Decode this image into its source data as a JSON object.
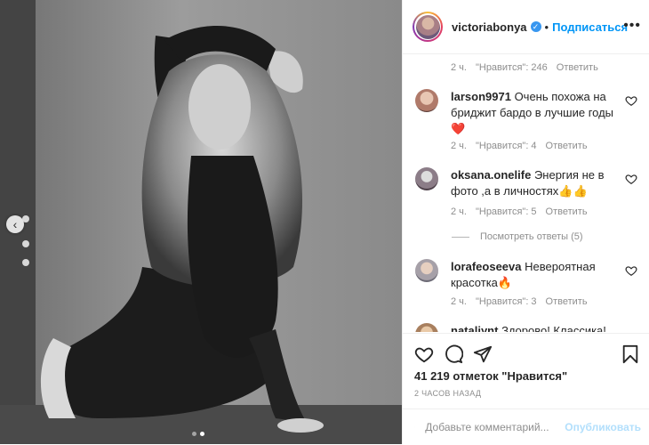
{
  "post": {
    "username": "victoriabonya",
    "follow_label": "Подписаться",
    "separator": "•",
    "more_label": "•••"
  },
  "comments": [
    {
      "username": "",
      "text": "",
      "time": "2 ч.",
      "likes": "\"Нравится\": 246",
      "reply": "Ответить"
    },
    {
      "username": "larson9971",
      "text": "Очень похожа на бриджит бардо в лучшие годы ❤️",
      "time": "2 ч.",
      "likes": "\"Нравится\": 4",
      "reply": "Ответить"
    },
    {
      "username": "oksana.onelife",
      "text": "Энергия не в фото ,а в личностях👍👍",
      "time": "2 ч.",
      "likes": "\"Нравится\": 5",
      "reply": "Ответить",
      "view_replies": "Посмотреть ответы (5)"
    },
    {
      "username": "lorafeoseeva",
      "text": "Невероятная красотка🔥",
      "time": "2 ч.",
      "likes": "\"Нравится\": 3",
      "reply": "Ответить"
    },
    {
      "username": "nataliynt",
      "text": "Здорово! Классика! 🔥",
      "time": "",
      "likes": "",
      "reply": ""
    }
  ],
  "likes_text": "41 219 отметок \"Нравится\"",
  "posted_time": "2 ЧАСОВ НАЗАД",
  "comment_input": {
    "placeholder": "Добавьте комментарий...",
    "post_label": "Опубликовать"
  },
  "icons": [
    "verified-icon",
    "more-icon",
    "like-icon",
    "comment-icon",
    "share-icon",
    "save-icon",
    "emoji-icon",
    "carousel-prev-icon"
  ],
  "colors": {
    "accent": "#0095f6",
    "verified": "#3897f0",
    "muted": "#8e8e8e"
  }
}
